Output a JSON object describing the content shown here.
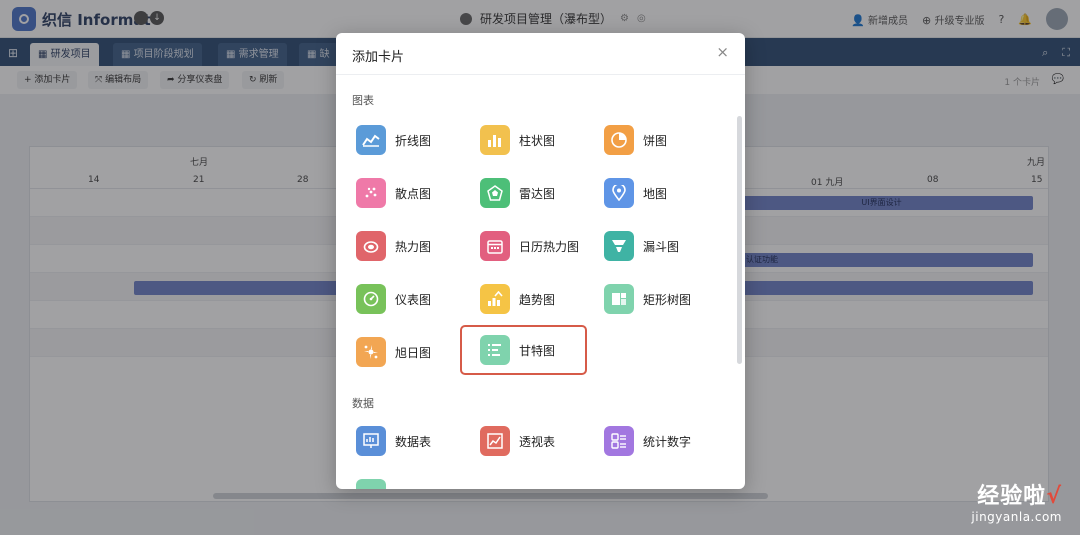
{
  "app": {
    "brand": "织信 Informat",
    "title": "研发项目管理（瀑布型）",
    "top_actions": {
      "invite": "新增成员",
      "upgrade": "升级专业版"
    }
  },
  "tabs": [
    "研发项目",
    "项目阶段规划",
    "需求管理",
    "缺"
  ],
  "toolbar": {
    "add_card": "添加卡片",
    "edit_layout": "编辑布局",
    "share_dashboard": "分享仪表盘",
    "refresh": "刷新",
    "card_count": "1 个卡片"
  },
  "gantt": {
    "months": [
      "七月",
      "九月"
    ],
    "days": [
      "14",
      "21",
      "28",
      "01 九月",
      "08",
      "15"
    ],
    "bars": [
      "UI界面设计",
      "认证功能"
    ]
  },
  "modal": {
    "title": "添加卡片",
    "close": "×",
    "sections": {
      "charts": "图表",
      "data": "数据"
    },
    "charts": [
      {
        "label": "折线图",
        "icon": "line-chart-icon",
        "color": "#5b9bd8"
      },
      {
        "label": "柱状图",
        "icon": "bar-chart-icon",
        "color": "#f2c14e"
      },
      {
        "label": "饼图",
        "icon": "pie-chart-icon",
        "color": "#f29f45"
      },
      {
        "label": "散点图",
        "icon": "scatter-chart-icon",
        "color": "#ef79a8"
      },
      {
        "label": "雷达图",
        "icon": "radar-chart-icon",
        "color": "#4dbf78"
      },
      {
        "label": "地图",
        "icon": "map-icon",
        "color": "#5f95e6"
      },
      {
        "label": "热力图",
        "icon": "heatmap-icon",
        "color": "#e0656a"
      },
      {
        "label": "日历热力图",
        "icon": "calendar-heatmap-icon",
        "color": "#e25f7f"
      },
      {
        "label": "漏斗图",
        "icon": "funnel-icon",
        "color": "#3fb3a4"
      },
      {
        "label": "仪表图",
        "icon": "gauge-icon",
        "color": "#78c25a"
      },
      {
        "label": "趋势图",
        "icon": "trend-icon",
        "color": "#f5c445"
      },
      {
        "label": "矩形树图",
        "icon": "treemap-icon",
        "color": "#7fd3ad"
      },
      {
        "label": "旭日图",
        "icon": "sunburst-icon",
        "color": "#f2a653"
      },
      {
        "label": "甘特图",
        "icon": "gantt-icon",
        "color": "#7fd3ad"
      }
    ],
    "data": [
      {
        "label": "数据表",
        "icon": "data-table-icon",
        "color": "#5a8fd8"
      },
      {
        "label": "透视表",
        "icon": "pivot-table-icon",
        "color": "#e06b5f"
      },
      {
        "label": "统计数字",
        "icon": "statistic-icon",
        "color": "#a277e0"
      }
    ],
    "selected": "甘特图"
  },
  "watermark": {
    "cn": "经验啦",
    "en": "jingyanla.com",
    "check": "√"
  }
}
